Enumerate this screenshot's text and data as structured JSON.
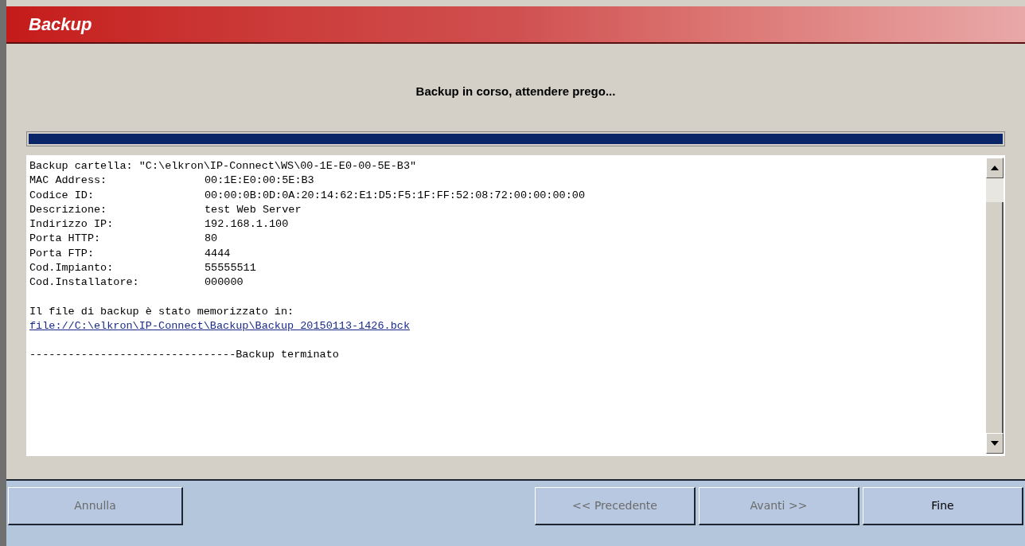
{
  "window": {
    "title": "Backup"
  },
  "status": {
    "text": "Backup in corso, attendere prego...",
    "level": 1
  },
  "log": {
    "sections": [
      {
        "lines": [
          {
            "kind": "text",
            "text": "Backup cartella: \"C:\\elkron\\IP-Connect\\WS\\00-1E-E0-00-5E-B3\""
          },
          {
            "kind": "field",
            "label": "MAC Address:",
            "value": "00:1E:E0:00:5E:B3"
          },
          {
            "kind": "field",
            "label": "Codice ID:",
            "value": "00:00:0B:0D:0A:20:14:62:E1:D5:F5:1F:FF:52:08:72:00:00:00:00"
          },
          {
            "kind": "field",
            "label": "Descrizione:",
            "value": "test Web Server"
          },
          {
            "kind": "field",
            "label": "Indirizzo IP:",
            "value": "192.168.1.100"
          },
          {
            "kind": "field",
            "label": "Porta HTTP:",
            "value": "80"
          },
          {
            "kind": "field",
            "label": "Porta FTP:",
            "value": "4444"
          },
          {
            "kind": "field",
            "label": "Cod.Impianto:",
            "value": "55555511"
          },
          {
            "kind": "field",
            "label": "Cod.Installatore:",
            "value": "000000"
          }
        ]
      },
      {
        "lines": [
          {
            "kind": "text",
            "text": "Il file di backup è stato memorizzato in:"
          },
          {
            "kind": "link",
            "text": "file://C:\\elkron\\IP-Connect\\Backup\\Backup 20150113-1426.bck"
          }
        ]
      },
      {
        "lines": [
          {
            "kind": "text",
            "text": "--------------------------------Backup terminato"
          }
        ]
      }
    ]
  },
  "buttons": [
    {
      "label": "Annulla",
      "disabled": true
    },
    {
      "label": "<< Precedente",
      "disabled": true
    },
    {
      "label": "Avanti >>",
      "disabled": true
    },
    {
      "label": "Fine",
      "disabled": false
    }
  ]
}
